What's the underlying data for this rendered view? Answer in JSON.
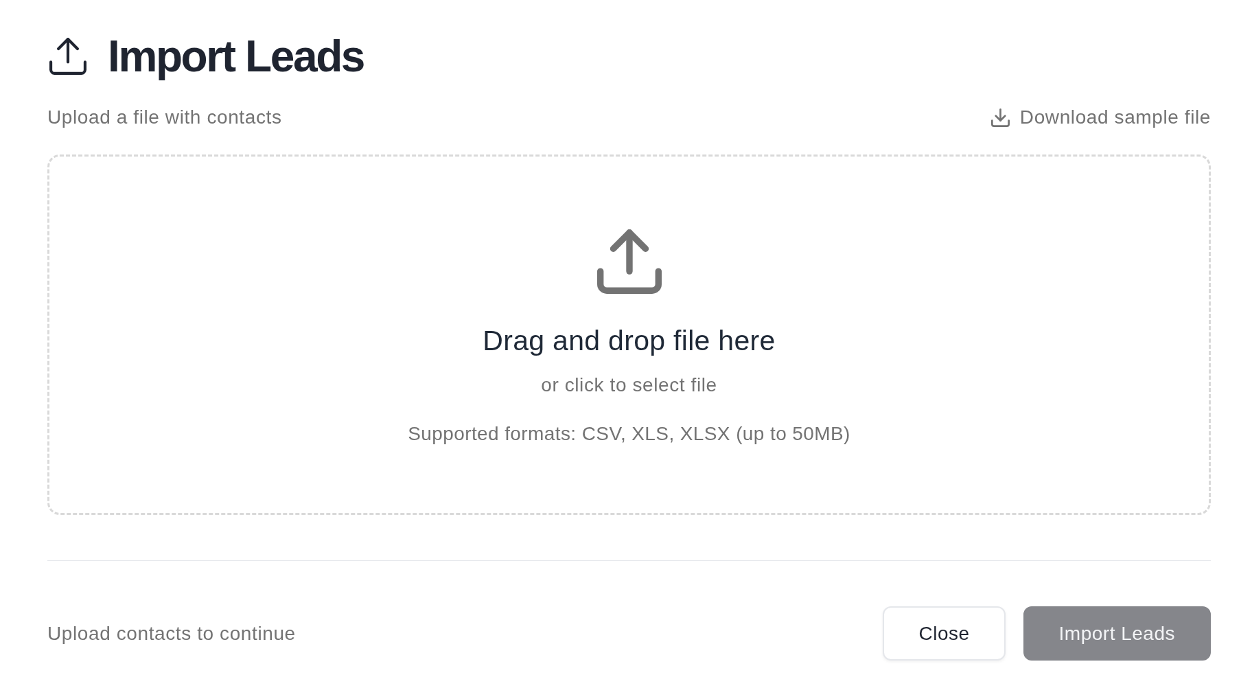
{
  "dialog": {
    "title": "Import Leads",
    "subtitle": "Upload a file with contacts",
    "download_link": "Download sample file"
  },
  "dropzone": {
    "heading": "Drag and drop file here",
    "hint": "or click to select file",
    "formats": "Supported formats: CSV, XLS, XLSX (up to 50MB)"
  },
  "footer": {
    "status": "Upload contacts to continue",
    "buttons": [
      {
        "label": "Close",
        "kind": "secondary",
        "disabled": false
      },
      {
        "label": "Import Leads",
        "kind": "primary",
        "disabled": true
      }
    ]
  }
}
